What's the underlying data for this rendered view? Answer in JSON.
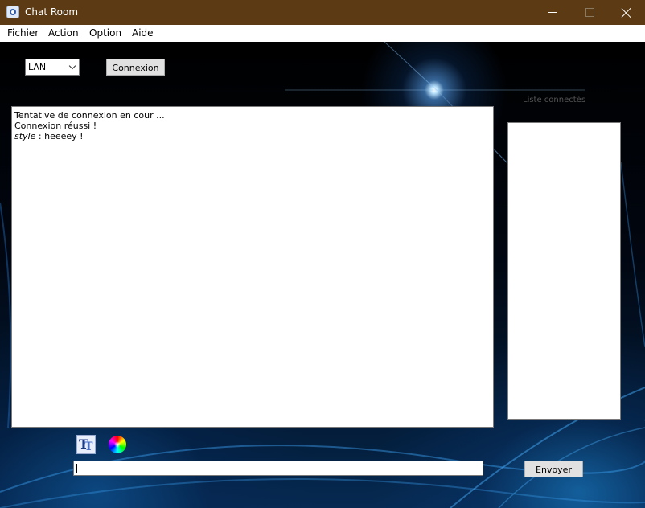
{
  "window": {
    "title": "Chat Room"
  },
  "menu": {
    "items": [
      "Fichier",
      "Action",
      "Option",
      "Aide"
    ]
  },
  "connection": {
    "network_select_value": "LAN",
    "connect_label": "Connexion"
  },
  "user_list": {
    "label": "Liste connectés"
  },
  "chat": {
    "messages": [
      {
        "text": "Tentative de connexion en cour ..."
      },
      {
        "text": "Connexion réussi !"
      },
      {
        "sender": "style",
        "separator": " : ",
        "text": "heeeey !"
      }
    ]
  },
  "composer": {
    "input_value": "",
    "send_label": "Envoyer"
  },
  "icons": {
    "app": "chat-app-icon",
    "font": "font-style-icon",
    "color": "color-wheel-icon"
  },
  "colors": {
    "titlebar": "#5b3a14",
    "background": "#000000",
    "accent": "#1e8fe0"
  }
}
